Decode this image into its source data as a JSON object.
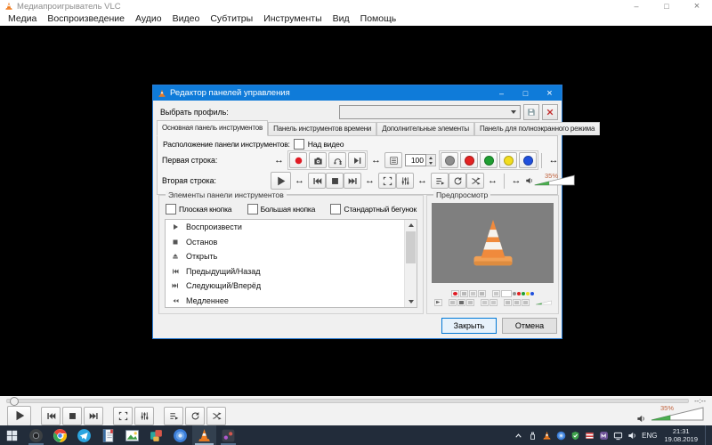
{
  "window": {
    "title": "Медиапроигрыватель VLC",
    "menu": [
      "Медиа",
      "Воспроизведение",
      "Аудио",
      "Видео",
      "Субтитры",
      "Инструменты",
      "Вид",
      "Помощь"
    ],
    "seek_time": "--:--",
    "volume_percent": "35%"
  },
  "dialog": {
    "title": "Редактор панелей управления",
    "profile_label": "Выбрать профиль:",
    "profile_value": "",
    "tabs": [
      "Основная панель инструментов",
      "Панель инструментов времени",
      "Дополнительные элементы",
      "Панель для полноэкранного режима"
    ],
    "active_tab": "Основная панель инструментов",
    "position_label": "Расположение панели инструментов:",
    "position_option": "Над видео",
    "row1_label": "Первая строка:",
    "row2_label": "Вторая строка:",
    "spin_value": "100",
    "volume_percent": "35%",
    "elements_title": "Элементы панели инструментов",
    "element_options": [
      "Плоская кнопка",
      "Большая кнопка",
      "Стандартный бегунок"
    ],
    "items": [
      {
        "icon": "play",
        "label": "Воспроизвести"
      },
      {
        "icon": "stop",
        "label": "Останов"
      },
      {
        "icon": "eject",
        "label": "Открыть"
      },
      {
        "icon": "prev",
        "label": "Предыдущий/Назад"
      },
      {
        "icon": "next",
        "label": "Следующий/Вперёд"
      },
      {
        "icon": "slower",
        "label": "Медленнее"
      }
    ],
    "preview_title": "Предпросмотр",
    "close_button": "Закрыть",
    "cancel_button": "Отмена"
  },
  "taskbar": {
    "tray": {
      "language": "ENG",
      "time": "21:31",
      "date": "19.08.2019"
    }
  },
  "colors": {
    "titlebar_blue": "#0f7bd9",
    "record_red": "#e01b24",
    "volume_green": "#4caf50",
    "cone_orange": "#ef8632",
    "percent_text": "#c0633e",
    "taskbar_dark": "#222c3a"
  }
}
